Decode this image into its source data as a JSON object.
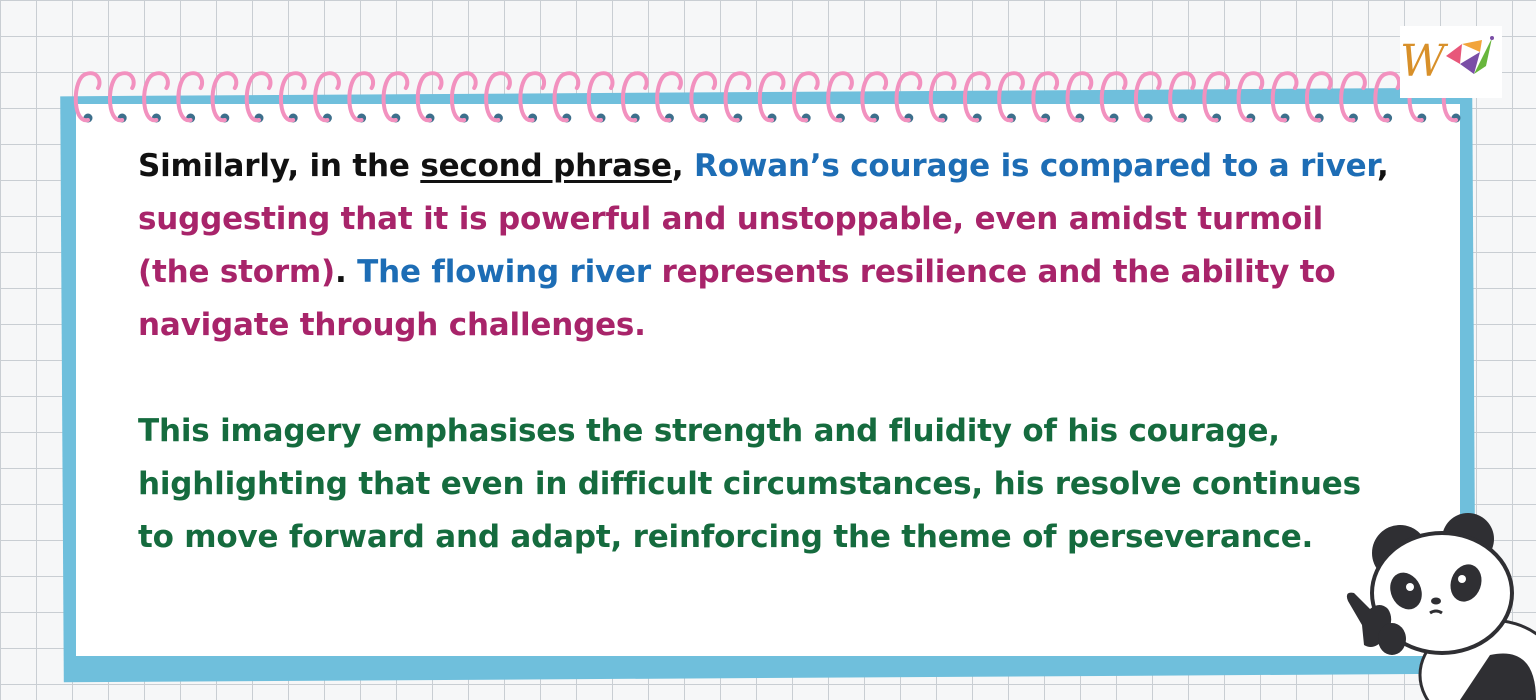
{
  "colors": {
    "grid": "#c9ced3",
    "frame": "#6fbfdc",
    "binding_rings": "#f291bf",
    "text_black": "#111111",
    "text_blue": "#1d6db5",
    "text_magenta": "#a8246a",
    "text_green": "#156b3e"
  },
  "logo": {
    "letter": "W",
    "icon": "brand-logo-icon"
  },
  "paragraph1": {
    "s1": "Similarly, in the ",
    "s2": "second phrase",
    "s3": ", ",
    "s4": "Rowan’s courage is compared to a river",
    "s5": ", ",
    "s6": "suggesting that it is powerful and unstoppable, even amidst turmoil (the storm)",
    "s7": ". ",
    "s8": "The flowing river",
    "s9": " represents resilience and the ability to navigate through challenges."
  },
  "paragraph2": "This imagery emphasises the strength and fluidity of his courage, highlighting that even in difficult circumstances, his resolve continues to move forward and adapt, reinforcing the theme of perseverance.",
  "decoration": {
    "mascot": "panda-pointing-icon",
    "binding": "spiral-binding-icon"
  }
}
